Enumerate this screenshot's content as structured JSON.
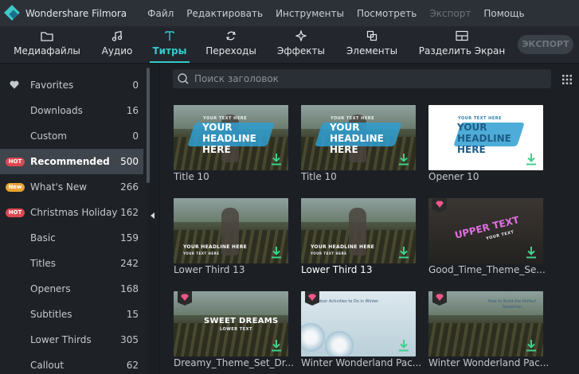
{
  "app": {
    "title": "Wondershare Filmora",
    "menu": [
      {
        "label": "Файл",
        "enabled": true
      },
      {
        "label": "Редактировать",
        "enabled": true
      },
      {
        "label": "Инструменты",
        "enabled": true
      },
      {
        "label": "Посмотреть",
        "enabled": true
      },
      {
        "label": "Экспорт",
        "enabled": false
      },
      {
        "label": "Помощь",
        "enabled": true
      }
    ]
  },
  "toolbar": {
    "tabs": [
      {
        "label": "Медиафайлы",
        "icon": "folder-icon",
        "active": false
      },
      {
        "label": "Аудио",
        "icon": "music-note-icon",
        "active": false
      },
      {
        "label": "Титры",
        "icon": "text-icon",
        "active": true
      },
      {
        "label": "Переходы",
        "icon": "transition-icon",
        "active": false
      },
      {
        "label": "Эффекты",
        "icon": "sparkle-icon",
        "active": false
      },
      {
        "label": "Элементы",
        "icon": "elements-icon",
        "active": false
      },
      {
        "label": "Разделить Экран",
        "icon": "split-screen-icon",
        "active": false
      }
    ],
    "export_label": "ЭКСПОРТ"
  },
  "sidebar": {
    "items": [
      {
        "name": "Favorites",
        "count": "0",
        "badge": "heart",
        "active": false
      },
      {
        "name": "Downloads",
        "count": "16",
        "badge": "",
        "active": false
      },
      {
        "name": "Custom",
        "count": "0",
        "badge": "",
        "active": false
      },
      {
        "name": "Recommended",
        "count": "500",
        "badge": "HOT",
        "active": true
      },
      {
        "name": "What's New",
        "count": "266",
        "badge": "New",
        "active": false
      },
      {
        "name": "Christmas Holiday",
        "count": "162",
        "badge": "HOT",
        "active": false
      },
      {
        "name": "Basic",
        "count": "159",
        "badge": "",
        "active": false
      },
      {
        "name": "Titles",
        "count": "242",
        "badge": "",
        "active": false
      },
      {
        "name": "Openers",
        "count": "168",
        "badge": "",
        "active": false
      },
      {
        "name": "Subtitles",
        "count": "15",
        "badge": "",
        "active": false
      },
      {
        "name": "Lower Thirds",
        "count": "305",
        "badge": "",
        "active": false
      },
      {
        "name": "Callout",
        "count": "62",
        "badge": "",
        "active": false
      }
    ]
  },
  "search": {
    "placeholder": "Поиск заголовок",
    "value": ""
  },
  "thumb_text": {
    "small": "YOUR TEXT HERE",
    "headline": "YOUR HEADLINE HERE",
    "lower_headline": "YOUR HEADLINE HERE",
    "lower_sub": "YOUR TEXT HERE",
    "upper": "UPPER TEXT",
    "upper_sub": "YOUR TEXT",
    "sweet": "SWEET DREAMS",
    "sweet_sub": "LOWER TEXT",
    "winter1": "Outdoor Activities to Do in Winter",
    "winter2": "How to Build the Perfect Snowman"
  },
  "items": [
    {
      "caption": "Title 10"
    },
    {
      "caption": "Title 10"
    },
    {
      "caption": "Opener 10"
    },
    {
      "caption": "Lower Third 13"
    },
    {
      "caption": "Lower Third 13"
    },
    {
      "caption": "Good_Time_Theme_Se..."
    },
    {
      "caption": "Dreamy_Theme_Set_Dr..."
    },
    {
      "caption": "Winter Wonderland Pac..."
    },
    {
      "caption": "Winter Wonderland Pac..."
    }
  ],
  "colors": {
    "accent": "#35c9c9",
    "hot_badge": "#e0474f",
    "new_badge": "#e8a330",
    "download_green": "#3fd08a",
    "premium_pink": "#f0568a"
  }
}
